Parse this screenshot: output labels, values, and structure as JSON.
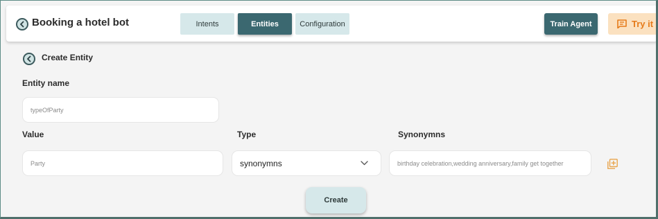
{
  "header": {
    "app_title": "Booking a hotel bot",
    "tabs": [
      {
        "label": "Intents"
      },
      {
        "label": "Entities"
      },
      {
        "label": "Configuration"
      }
    ],
    "active_tab": "Entities",
    "train_label": "Train Agent",
    "try_label": "Try it"
  },
  "page": {
    "title": "Create Entity",
    "entity_name_label": "Entity name",
    "entity_name_value": "typeOfParty",
    "value_label": "Value",
    "type_label": "Type",
    "synonyms_label": "Synonymns",
    "value_value": "Party",
    "type_selected": "synonymns",
    "synonyms_value": "birthday celebration,wedding anniversary,family get together",
    "create_label": "Create"
  },
  "colors": {
    "primary": "#3b6870",
    "tab_bg": "#d6e8ea",
    "try_bg": "#fbe1c0",
    "try_fg": "#e67b1a",
    "add_icon": "#e8a44b"
  },
  "icons": {
    "back": "chevron-left-circle-icon",
    "try": "chat-bubble-icon",
    "dropdown": "chevron-down-icon",
    "add": "add-box-icon"
  }
}
